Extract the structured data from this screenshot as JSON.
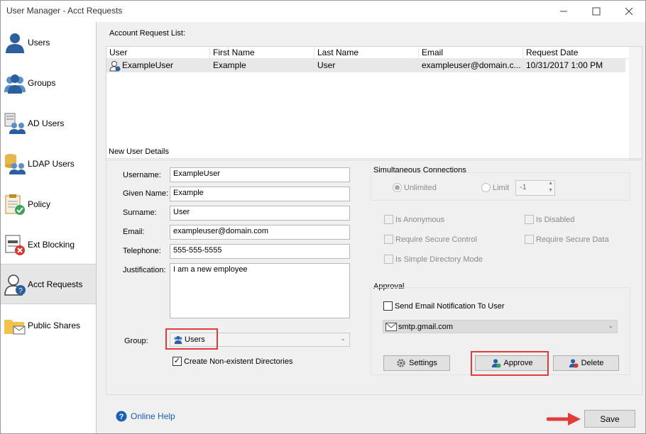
{
  "window": {
    "title": "User Manager - Acct Requests"
  },
  "sidebar": {
    "items": [
      {
        "label": "Users",
        "icon": "user-icon"
      },
      {
        "label": "Groups",
        "icon": "group-icon"
      },
      {
        "label": "AD Users",
        "icon": "ad-users-icon"
      },
      {
        "label": "LDAP Users",
        "icon": "ldap-users-icon"
      },
      {
        "label": "Policy",
        "icon": "policy-icon"
      },
      {
        "label": "Ext Blocking",
        "icon": "ext-blocking-icon"
      },
      {
        "label": "Acct Requests",
        "icon": "acct-requests-icon",
        "active": true
      },
      {
        "label": "Public Shares",
        "icon": "public-shares-icon"
      }
    ]
  },
  "request_list": {
    "label": "Account Request List:",
    "columns": [
      "User",
      "First Name",
      "Last Name",
      "Email",
      "Request Date"
    ],
    "rows": [
      [
        "ExampleUser",
        "Example",
        "User",
        "exampleuser@domain.c...",
        "10/31/2017 1:00 PM"
      ]
    ]
  },
  "details": {
    "label": "New User Details",
    "username_label": "Username:",
    "username": "ExampleUser",
    "given_label": "Given Name:",
    "given": "Example",
    "surname_label": "Surname:",
    "surname": "User",
    "email_label": "Email:",
    "email": "exampleuser@domain.com",
    "phone_label": "Telephone:",
    "phone": "555-555-5555",
    "justification_label": "Justification:",
    "justification": "I am a new employee",
    "group_label": "Group:",
    "group": "Users",
    "create_dirs": "Create Non-existent Directories"
  },
  "connections": {
    "label": "Simultaneous Connections",
    "unlimited": "Unlimited",
    "limit": "Limit",
    "limit_value": "-1"
  },
  "options": {
    "is_anonymous": "Is Anonymous",
    "is_disabled": "Is Disabled",
    "require_secure_control": "Require Secure Control",
    "require_secure_data": "Require Secure Data",
    "is_simple_directory": "Is Simple Directory Mode"
  },
  "approval": {
    "label": "Approval",
    "send_email": "Send Email Notification To User",
    "smtp": "smtp.gmail.com"
  },
  "buttons": {
    "settings": "Settings",
    "approve": "Approve",
    "delete": "Delete",
    "save": "Save"
  },
  "help": {
    "label": "Online Help"
  },
  "colors": {
    "highlight": "#e03c3c",
    "link": "#1a5fb4"
  }
}
